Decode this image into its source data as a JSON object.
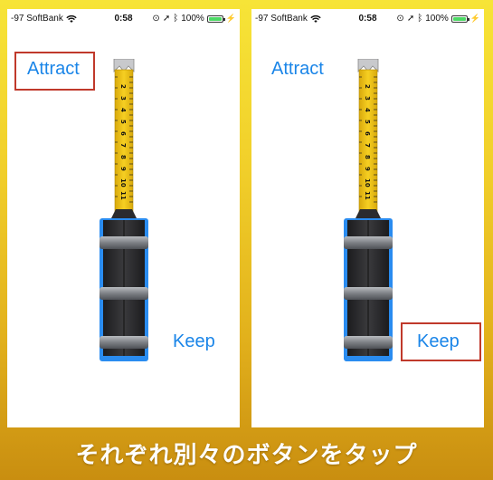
{
  "colors": {
    "button_text": "#1a85e8",
    "highlight_border": "#c0392b",
    "tape_yellow": "#f2c418",
    "case_blue": "#2a8cf0"
  },
  "screens": [
    {
      "status": {
        "carrier": "-97 SoftBank",
        "time": "0:58",
        "battery": "100%"
      },
      "attract_label": "Attract",
      "keep_label": "Keep",
      "highlighted": "attract",
      "ruler_numbers": [
        "2",
        "3",
        "4",
        "5",
        "6",
        "7",
        "8",
        "9",
        "10",
        "11"
      ]
    },
    {
      "status": {
        "carrier": "-97 SoftBank",
        "time": "0:58",
        "battery": "100%"
      },
      "attract_label": "Attract",
      "keep_label": "Keep",
      "highlighted": "keep",
      "ruler_numbers": [
        "2",
        "3",
        "4",
        "5",
        "6",
        "7",
        "8",
        "9",
        "10",
        "11"
      ]
    }
  ],
  "caption": "それぞれ別々のボタンをタップ"
}
